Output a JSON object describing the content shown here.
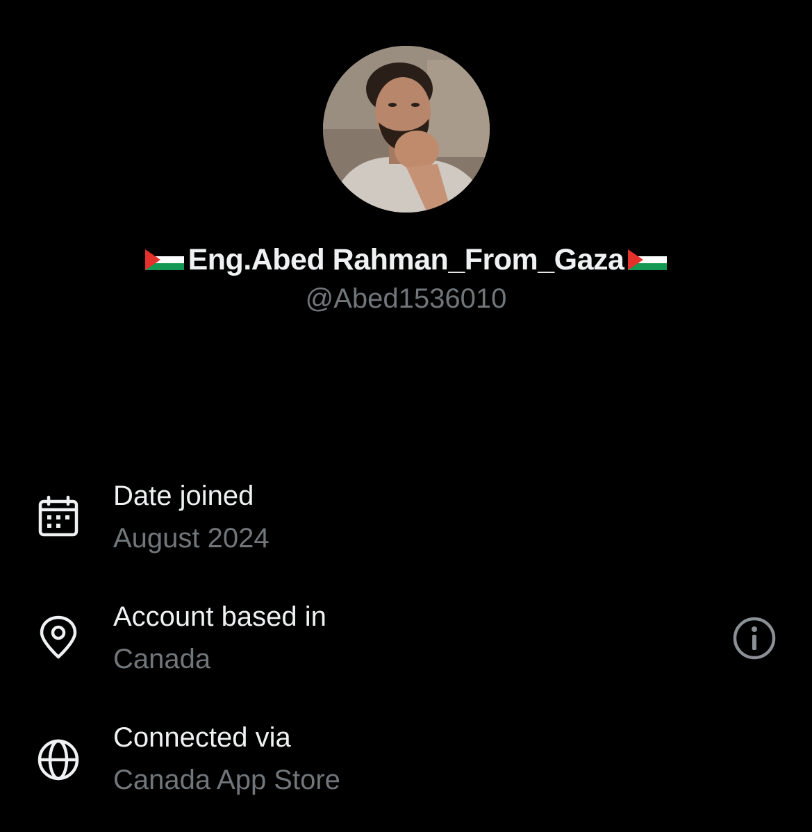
{
  "profile": {
    "display_name": "Eng.Abed Rahman_From_Gaza",
    "handle": "@Abed1536010",
    "name_prefix_icon": "palestine-flag-emoji",
    "name_suffix_icon": "palestine-flag-emoji"
  },
  "details": {
    "date_joined": {
      "icon": "calendar-icon",
      "label": "Date joined",
      "value": "August 2024"
    },
    "account_based_in": {
      "icon": "location-pin-icon",
      "label": "Account based in",
      "value": "Canada",
      "action_icon": "info-icon"
    },
    "connected_via": {
      "icon": "globe-icon",
      "label": "Connected via",
      "value": "Canada App Store"
    }
  },
  "colors": {
    "background": "#000000",
    "primary_text": "#eff1f2",
    "secondary_text": "#71767b",
    "flag_black": "#000000",
    "flag_white": "#ffffff",
    "flag_green": "#149954",
    "flag_red": "#e4312b"
  }
}
